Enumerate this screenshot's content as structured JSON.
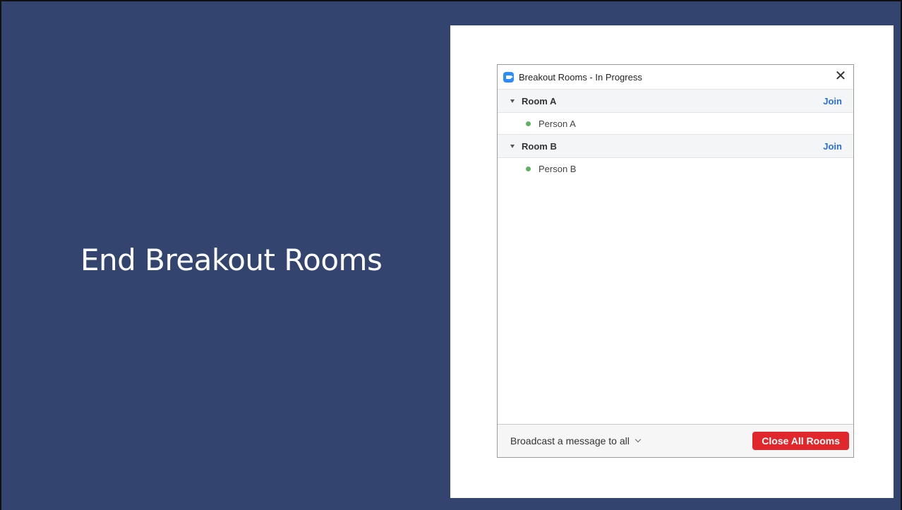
{
  "slide": {
    "title": "End Breakout Rooms"
  },
  "window": {
    "title": "Breakout Rooms - In Progress",
    "close_glyph": "✕"
  },
  "rooms": [
    {
      "name": "Room A",
      "join_label": "Join",
      "participants": [
        "Person A"
      ]
    },
    {
      "name": "Room B",
      "join_label": "Join",
      "participants": [
        "Person B"
      ]
    }
  ],
  "footer": {
    "broadcast_label": "Broadcast a message to all",
    "close_all_label": "Close All Rooms"
  },
  "colors": {
    "slide_bg": "#33446e",
    "accent_blue": "#2a6fd1",
    "close_red": "#e0272c",
    "online_green": "#5fb35f",
    "app_icon": "#2d8cff"
  },
  "icons": {
    "app": "zoom-camera-icon",
    "close": "close-icon",
    "room_toggle": "caret-down-icon",
    "status": "online-dot-icon",
    "broadcast": "chevron-down-icon"
  }
}
